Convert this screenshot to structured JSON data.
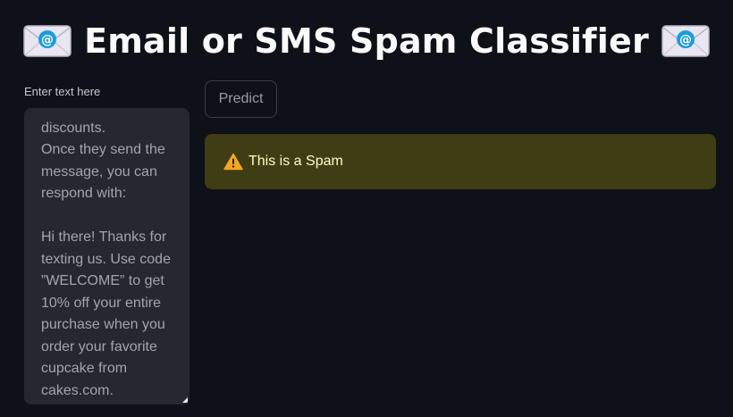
{
  "title": {
    "text": "Email or SMS Spam Classifier",
    "leading_icon": "envelope-email-icon",
    "trailing_icon": "envelope-email-icon"
  },
  "input": {
    "label": "Enter text here",
    "value_visible": "discounts.\nOnce they send the message, you can respond with:\n\nHi there! Thanks for texting us. Use code ”WELCOME” to get 10% off your entire purchase when you order your favorite cupcake from cakes.com."
  },
  "predict_button": {
    "label": "Predict"
  },
  "result": {
    "icon": "warning-icon",
    "text": "This is a Spam",
    "color": "#3e3d13"
  },
  "colors": {
    "background": "#0e1117",
    "textarea_bg": "#262730",
    "alert_text": "#fdfbc8"
  }
}
